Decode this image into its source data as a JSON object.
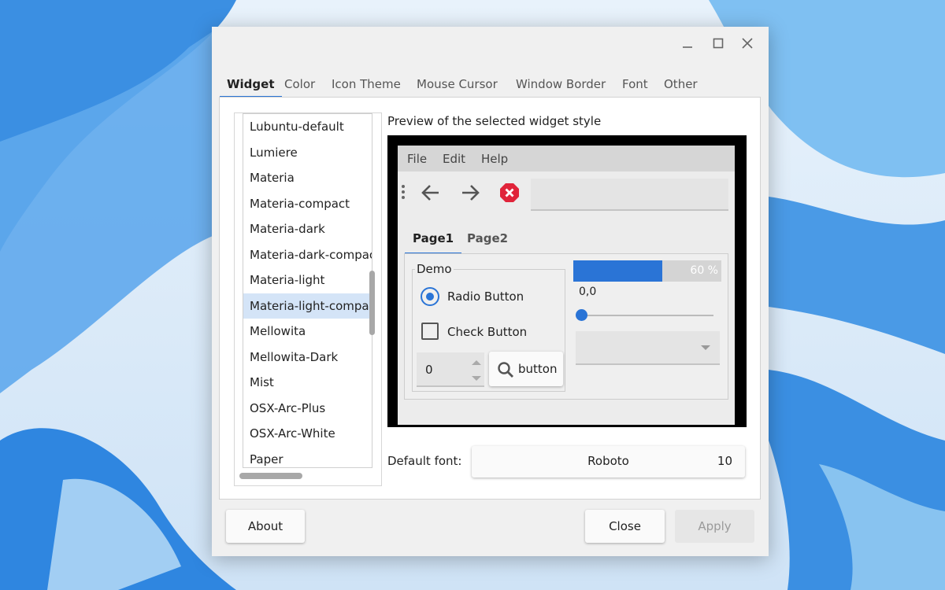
{
  "colors": {
    "accent": "#2a74d6",
    "window_bg": "#f0f0f0",
    "selected_row": "#d4e4f7",
    "close_icon": "#e0243a"
  },
  "titlebar": {
    "icons": [
      "minimize-icon",
      "maximize-icon",
      "close-icon"
    ]
  },
  "tabs": [
    {
      "label": "Widget",
      "active": true
    },
    {
      "label": "Color"
    },
    {
      "label": "Icon Theme"
    },
    {
      "label": "Mouse Cursor"
    },
    {
      "label": "Window Border"
    },
    {
      "label": "Font"
    },
    {
      "label": "Other"
    }
  ],
  "theme_list": {
    "items": [
      "Lubuntu-default",
      "Lumiere",
      "Materia",
      "Materia-compact",
      "Materia-dark",
      "Materia-dark-compact",
      "Materia-light",
      "Materia-light-compact",
      "Mellowita",
      "Mellowita-Dark",
      "Mist",
      "OSX-Arc-Plus",
      "OSX-Arc-White",
      "Paper"
    ],
    "selected": "Materia-light-compact"
  },
  "preview": {
    "label": "Preview of the selected widget style",
    "menu": [
      "File",
      "Edit",
      "Help"
    ],
    "toolbar_icons": [
      "back-arrow-icon",
      "forward-arrow-icon",
      "stop-icon"
    ],
    "tabs": [
      "Page1",
      "Page2"
    ],
    "group_title": "Demo",
    "radio_label": "Radio Button",
    "check_label": "Check Button",
    "spin_value": "0",
    "button_label": "button",
    "progress_value": 60,
    "progress_text": "60 %",
    "slider_value_text": "0,0",
    "slider_value": 0
  },
  "font": {
    "label": "Default font:",
    "name": "Roboto",
    "size": "10"
  },
  "buttons": {
    "about": "About",
    "close": "Close",
    "apply": "Apply"
  }
}
